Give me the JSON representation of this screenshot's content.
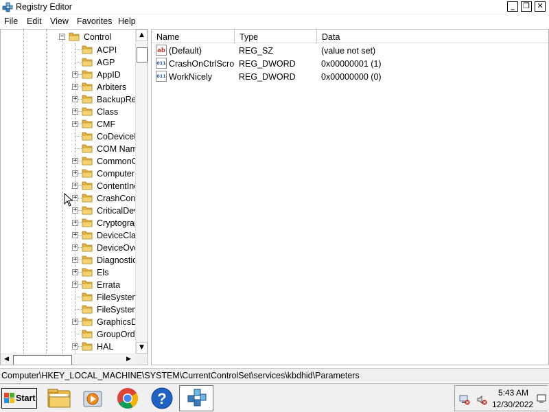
{
  "window": {
    "title": "Registry Editor",
    "minimize_glyph": "_",
    "restore_glyph": "❐",
    "close_glyph": "✕"
  },
  "menu": [
    "File",
    "Edit",
    "View",
    "Favorites",
    "Help"
  ],
  "tree": {
    "parent": {
      "label": "Control",
      "expander": "−"
    },
    "items": [
      {
        "label": "ACPI",
        "expandable": false
      },
      {
        "label": "AGP",
        "expandable": false
      },
      {
        "label": "AppID",
        "expandable": true
      },
      {
        "label": "Arbiters",
        "expandable": true
      },
      {
        "label": "BackupRes",
        "expandable": true
      },
      {
        "label": "Class",
        "expandable": true
      },
      {
        "label": "CMF",
        "expandable": true
      },
      {
        "label": "CoDeviceIr",
        "expandable": false
      },
      {
        "label": "COM Nam",
        "expandable": false
      },
      {
        "label": "CommonG",
        "expandable": true
      },
      {
        "label": "ComputerI",
        "expandable": true
      },
      {
        "label": "ContentInc",
        "expandable": true
      },
      {
        "label": "CrashCont",
        "expandable": true
      },
      {
        "label": "CriticalDev",
        "expandable": true
      },
      {
        "label": "Cryptograp",
        "expandable": true
      },
      {
        "label": "DeviceClas",
        "expandable": true
      },
      {
        "label": "DeviceOve",
        "expandable": true
      },
      {
        "label": "Diagnostic",
        "expandable": true
      },
      {
        "label": "Els",
        "expandable": true
      },
      {
        "label": "Errata",
        "expandable": true
      },
      {
        "label": "FileSystem",
        "expandable": false
      },
      {
        "label": "FileSystem",
        "expandable": false
      },
      {
        "label": "GraphicsDr",
        "expandable": true
      },
      {
        "label": "GroupOrde",
        "expandable": false
      },
      {
        "label": "HAL",
        "expandable": true
      }
    ],
    "expand_glyph": "+"
  },
  "scrollbar": {
    "up": "▲",
    "down": "▼",
    "left": "◀",
    "right": "▶"
  },
  "list": {
    "columns": [
      "Name",
      "Type",
      "Data"
    ],
    "rows": [
      {
        "icon": "string-value-icon",
        "icon_text": "ab",
        "name": "(Default)",
        "type": "REG_SZ",
        "data": "(value not set)"
      },
      {
        "icon": "binary-value-icon",
        "icon_text": "011",
        "name": "CrashOnCtrlScroll",
        "type": "REG_DWORD",
        "data": "0x00000001 (1)"
      },
      {
        "icon": "binary-value-icon",
        "icon_text": "011",
        "name": "WorkNicely",
        "type": "REG_DWORD",
        "data": "0x00000000 (0)"
      }
    ]
  },
  "status": {
    "path": "Computer\\HKEY_LOCAL_MACHINE\\SYSTEM\\CurrentControlSet\\services\\kbdhid\\Parameters"
  },
  "taskbar": {
    "start_label": "Start",
    "apps": [
      "file-explorer-icon",
      "media-player-icon",
      "chrome-icon",
      "help-icon",
      "registry-editor-icon"
    ],
    "help_glyph": "?",
    "active_app": "registry-editor-icon"
  },
  "clock": {
    "time": "5:43 AM",
    "date": "12/30/2022"
  },
  "colors": {
    "folder": "#e8b53c",
    "help_blue": "#1f63c4",
    "tray_red": "#d02020",
    "tree_dots": "#a0a0a0"
  }
}
